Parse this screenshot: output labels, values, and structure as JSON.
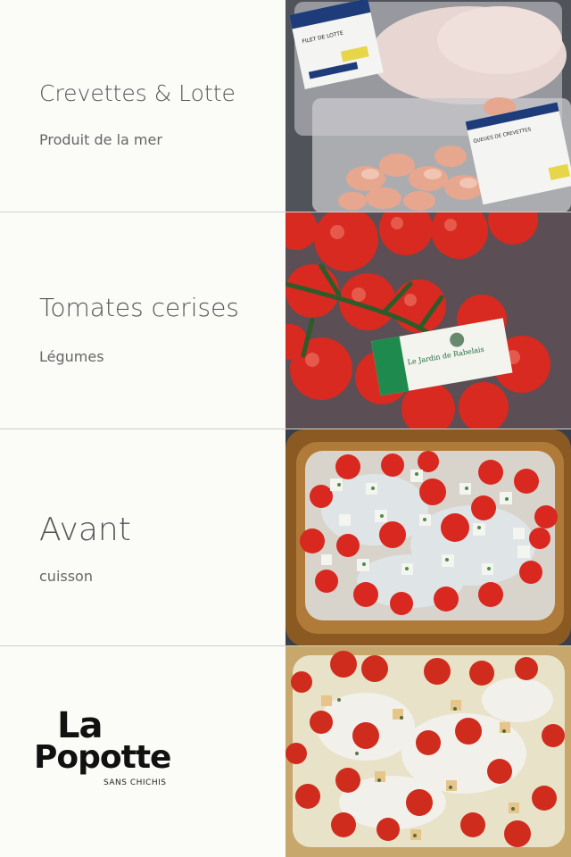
{
  "rows": [
    {
      "title": "Crevettes & Lotte",
      "subtitle": "Produit de la mer",
      "photo": "packaged-seafood-photo"
    },
    {
      "title": "Tomates cerises",
      "subtitle": "Légumes",
      "photo": "cherry-tomatoes-photo"
    },
    {
      "title": "Avant",
      "subtitle": "cuisson",
      "photo": "raw-dish-photo"
    },
    {
      "title": "",
      "subtitle": "",
      "photo": "cooked-dish-photo"
    }
  ],
  "photo_labels": {
    "lotte_pack": "FILET DE LOTTE",
    "shrimp_pack": "QUEUES DE CREVETTES",
    "garden_card": "Le Jardin de Rabelais"
  },
  "logo": {
    "line1": "La",
    "line2": "Popotte",
    "tagline": "SANS CHICHIS"
  },
  "colors": {
    "tomato": "#d8281f",
    "background": "#fbfbf8",
    "text": "#555555"
  }
}
